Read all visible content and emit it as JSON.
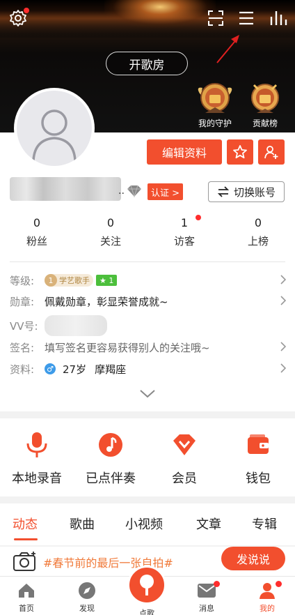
{
  "header": {
    "kge_button": "开歌房",
    "badges": [
      {
        "label": "我的守护"
      },
      {
        "label": "贡献榜"
      }
    ]
  },
  "profile": {
    "edit_button": "编辑资料",
    "name_suffix": "..",
    "verify_label": "认证 >",
    "switch_account": "切换账号"
  },
  "stats": [
    {
      "value": "0",
      "label": "粉丝"
    },
    {
      "value": "0",
      "label": "关注"
    },
    {
      "value": "1",
      "label": "访客"
    },
    {
      "value": "0",
      "label": "上榜"
    }
  ],
  "info": {
    "level": {
      "key": "等级:",
      "title": "学艺歌手",
      "level_num": "1",
      "vip_level": "1"
    },
    "medal": {
      "key": "勋章:",
      "value": "佩戴勋章，彰显荣誉成就~"
    },
    "vv": {
      "key": "VV号:"
    },
    "signature": {
      "key": "签名:",
      "value": "填写签名更容易获得别人的关注哦~"
    },
    "profile": {
      "key": "资料:",
      "gender_icon": "male-icon",
      "age": "27岁",
      "zodiac": "摩羯座"
    }
  },
  "actions": [
    {
      "label": "本地录音",
      "icon": "microphone-icon"
    },
    {
      "label": "已点伴奏",
      "icon": "music-note-icon"
    },
    {
      "label": "会员",
      "icon": "vip-diamond-icon"
    },
    {
      "label": "钱包",
      "icon": "wallet-icon"
    }
  ],
  "tabs": [
    "动态",
    "歌曲",
    "小视频",
    "文章",
    "专辑"
  ],
  "post": {
    "topic": "#春节前的最后一张自拍#",
    "button": "发说说"
  },
  "bottom_nav": {
    "home": "首页",
    "discover": "发现",
    "sing": "点歌",
    "messages": "消息",
    "mine": "我的"
  },
  "colors": {
    "accent": "#f24f2e",
    "badge_green": "#4cbf3c"
  }
}
